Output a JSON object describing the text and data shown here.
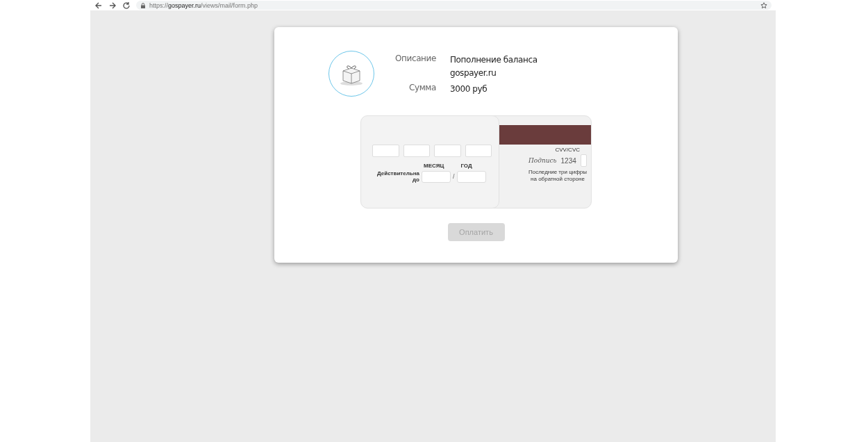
{
  "browser": {
    "url": "https://**gospayer.ru**/views/mail/form.php"
  },
  "order": {
    "rows": [
      {
        "label": "Описание",
        "value": "Пополнение баланса gospayer.ru"
      },
      {
        "label": "Сумма",
        "value": "3000 руб"
      }
    ]
  },
  "card_front": {
    "month_label": "МЕСЯЦ",
    "year_label": "ГОД",
    "expiry_label": "Действительна до",
    "separator": "/"
  },
  "card_back": {
    "cvv_label": "CVV/CVC",
    "signature": "Подпись",
    "signature_number": "1234",
    "cvv_hint": "Последние три цифры на обратной стороне"
  },
  "pay_button": {
    "label": "Оплатить",
    "disabled": true
  }
}
